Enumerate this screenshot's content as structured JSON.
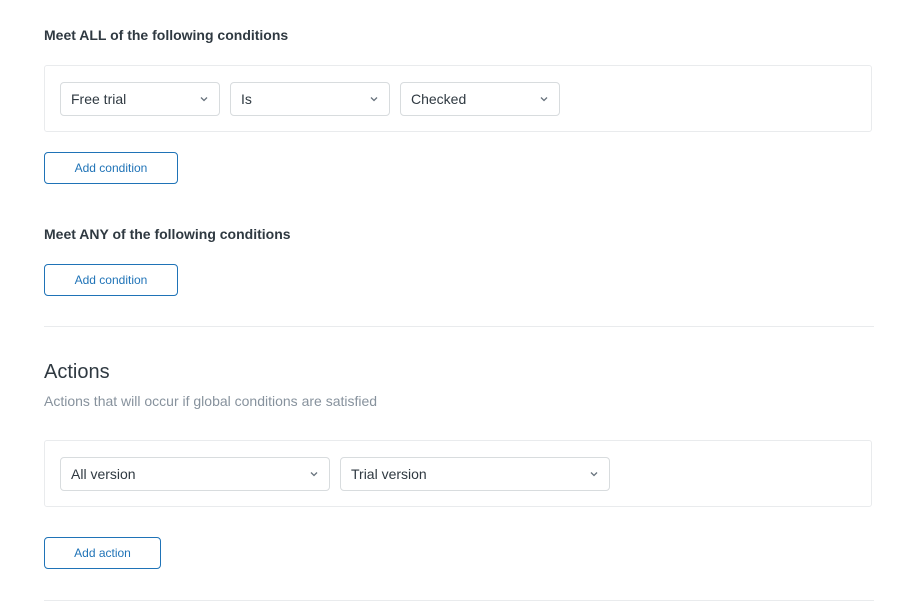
{
  "all_conditions": {
    "heading": "Meet ALL of the following conditions",
    "rows": [
      {
        "field": "Free trial",
        "operator": "Is",
        "value": "Checked"
      }
    ],
    "add_label": "Add condition"
  },
  "any_conditions": {
    "heading": "Meet ANY of the following conditions",
    "add_label": "Add condition"
  },
  "actions": {
    "title": "Actions",
    "subtitle": "Actions that will occur if global conditions are satisfied",
    "rows": [
      {
        "field": "All version",
        "value": "Trial version"
      }
    ],
    "add_label": "Add action"
  },
  "colors": {
    "accent": "#1f73b7",
    "text": "#2f3941",
    "muted": "#87929d",
    "border": "#d8dcde"
  },
  "icons": {
    "dropdown": "chevron-down-icon"
  }
}
